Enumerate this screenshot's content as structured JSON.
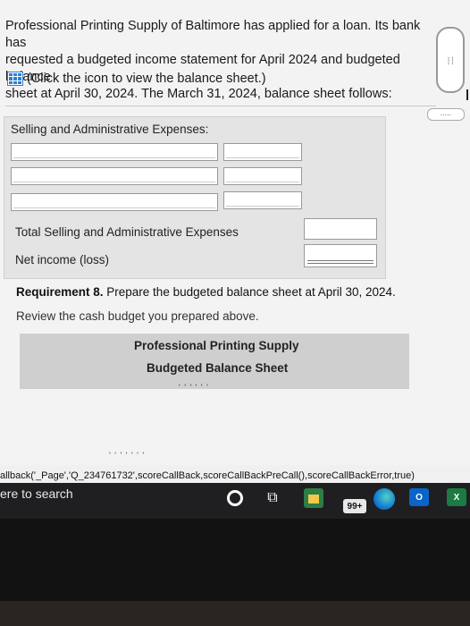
{
  "intro": {
    "line1": "Professional Printing Supply of Baltimore has applied for a loan. Its bank has",
    "line2": "requested a budgeted income statement for April 2024 and budgeted balance",
    "line3": "sheet at April 30, 2024. The March 31, 2024, balance sheet follows:",
    "link_text": "(Click the icon to view the balance sheet.)"
  },
  "scroll_handle": ":::::",
  "dots_button": ".....",
  "expenses": {
    "title": "Selling and Administrative Expenses:",
    "total_label": "Total Selling and Administrative Expenses",
    "net_label": "Net income (loss)"
  },
  "requirement": {
    "label": "Requirement 8.",
    "text": " Prepare the budgeted balance sheet at April 30, 2024.",
    "review": "Review the cash budget you prepared above."
  },
  "balance_sheet": {
    "title": "Professional Printing Supply",
    "subtitle": "Budgeted Balance Sheet",
    "partial": "' ' ' ' ' '"
  },
  "console": {
    "callback": "allback('_Page','Q_234761732',scoreCallBack,scoreCallBackPreCall(),scoreCallBackError,true)",
    "partial": "' ' ' ' ' ' '"
  },
  "taskbar": {
    "search": "ere to search",
    "badge": "99+",
    "outlook": "O",
    "excel": "X"
  }
}
